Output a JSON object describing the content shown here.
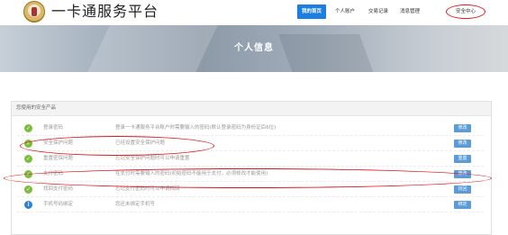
{
  "header": {
    "site_title": "一卡通服务平台",
    "nav": [
      {
        "label": "我的首页",
        "active": true
      },
      {
        "label": "个人账户",
        "active": false
      },
      {
        "label": "交易记录",
        "active": false
      },
      {
        "label": "消息管理",
        "active": false
      },
      {
        "label": "安全中心",
        "active": false,
        "annotated": true
      }
    ]
  },
  "banner": {
    "title": "个人信息"
  },
  "security_panel": {
    "heading": "您使用的安全产品",
    "rows": [
      {
        "icon": "check-icon",
        "name": "登录密码",
        "description": "登录一卡通服务平台账户时需要输入的密码(默认登录密码为身份证后6位)",
        "button": "修改"
      },
      {
        "icon": "check-icon",
        "name": "安全保护问题",
        "description": "已经设置安全保护问题",
        "button": "修改"
      },
      {
        "icon": "check-icon",
        "name": "重置密保问题",
        "description": "忘记安全保护问题时可以申请重置",
        "button": "重置"
      },
      {
        "icon": "check-icon",
        "name": "支付密码",
        "description": "在支付时需要输入的密码(初始密码不能用于支付，必须修改才能使用)",
        "button": "修改"
      },
      {
        "icon": "check-icon",
        "name": "找回支付密码",
        "description": "忘记支付密码时可以申请找回",
        "button": "找回"
      },
      {
        "icon": "info-icon",
        "name": "手机号码绑定",
        "description": "您还未绑定手机号",
        "button": "绑定"
      }
    ]
  },
  "colors": {
    "nav_active": "#1c7ee0",
    "annotation_red": "#e0161a",
    "status_ok": "#7cbd3a",
    "status_info": "#2f83d6",
    "row_button": "#5a9bd8"
  }
}
